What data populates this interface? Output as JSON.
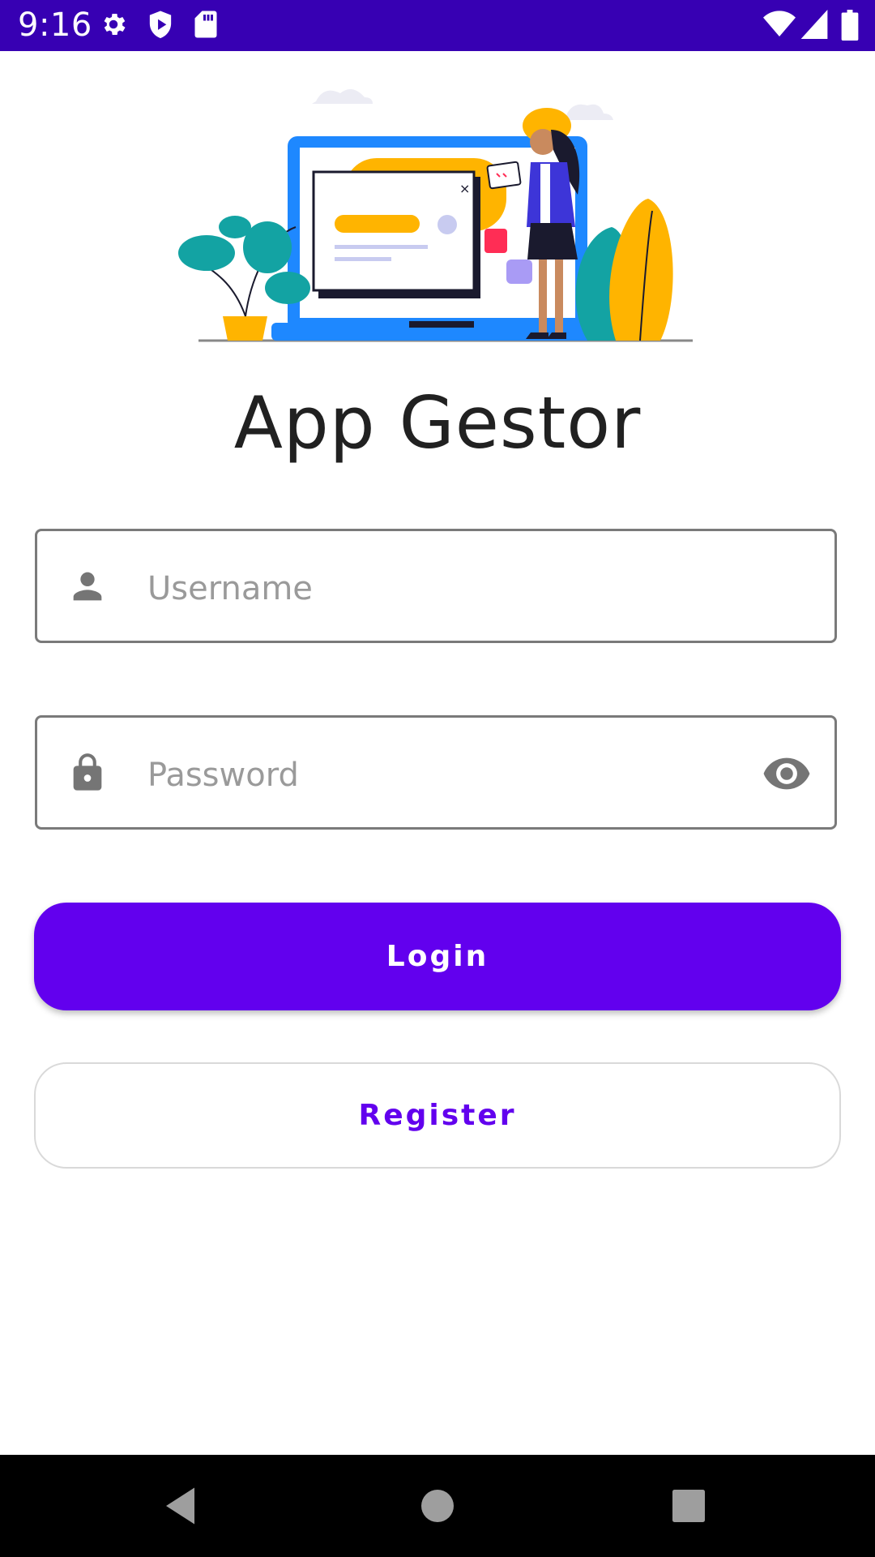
{
  "status_bar": {
    "time": "9:16",
    "background_color": "#3700b3",
    "icons_left": [
      "gear-icon",
      "play-protect-icon",
      "sd-card-icon"
    ],
    "icons_right": [
      "wifi-icon",
      "cell-signal-icon",
      "battery-icon"
    ]
  },
  "illustration": {
    "icon": "login-illustration"
  },
  "app": {
    "title": "App Gestor"
  },
  "form": {
    "username": {
      "placeholder": "Username",
      "value": "",
      "icon": "person-icon"
    },
    "password": {
      "placeholder": "Password",
      "value": "",
      "icon": "lock-icon",
      "toggle_icon": "eye-icon"
    }
  },
  "buttons": {
    "login_label": "Login",
    "register_label": "Register",
    "accent_color": "#6200ee"
  },
  "nav_bar": {
    "icons": [
      "back-icon",
      "home-icon",
      "recents-icon"
    ]
  }
}
